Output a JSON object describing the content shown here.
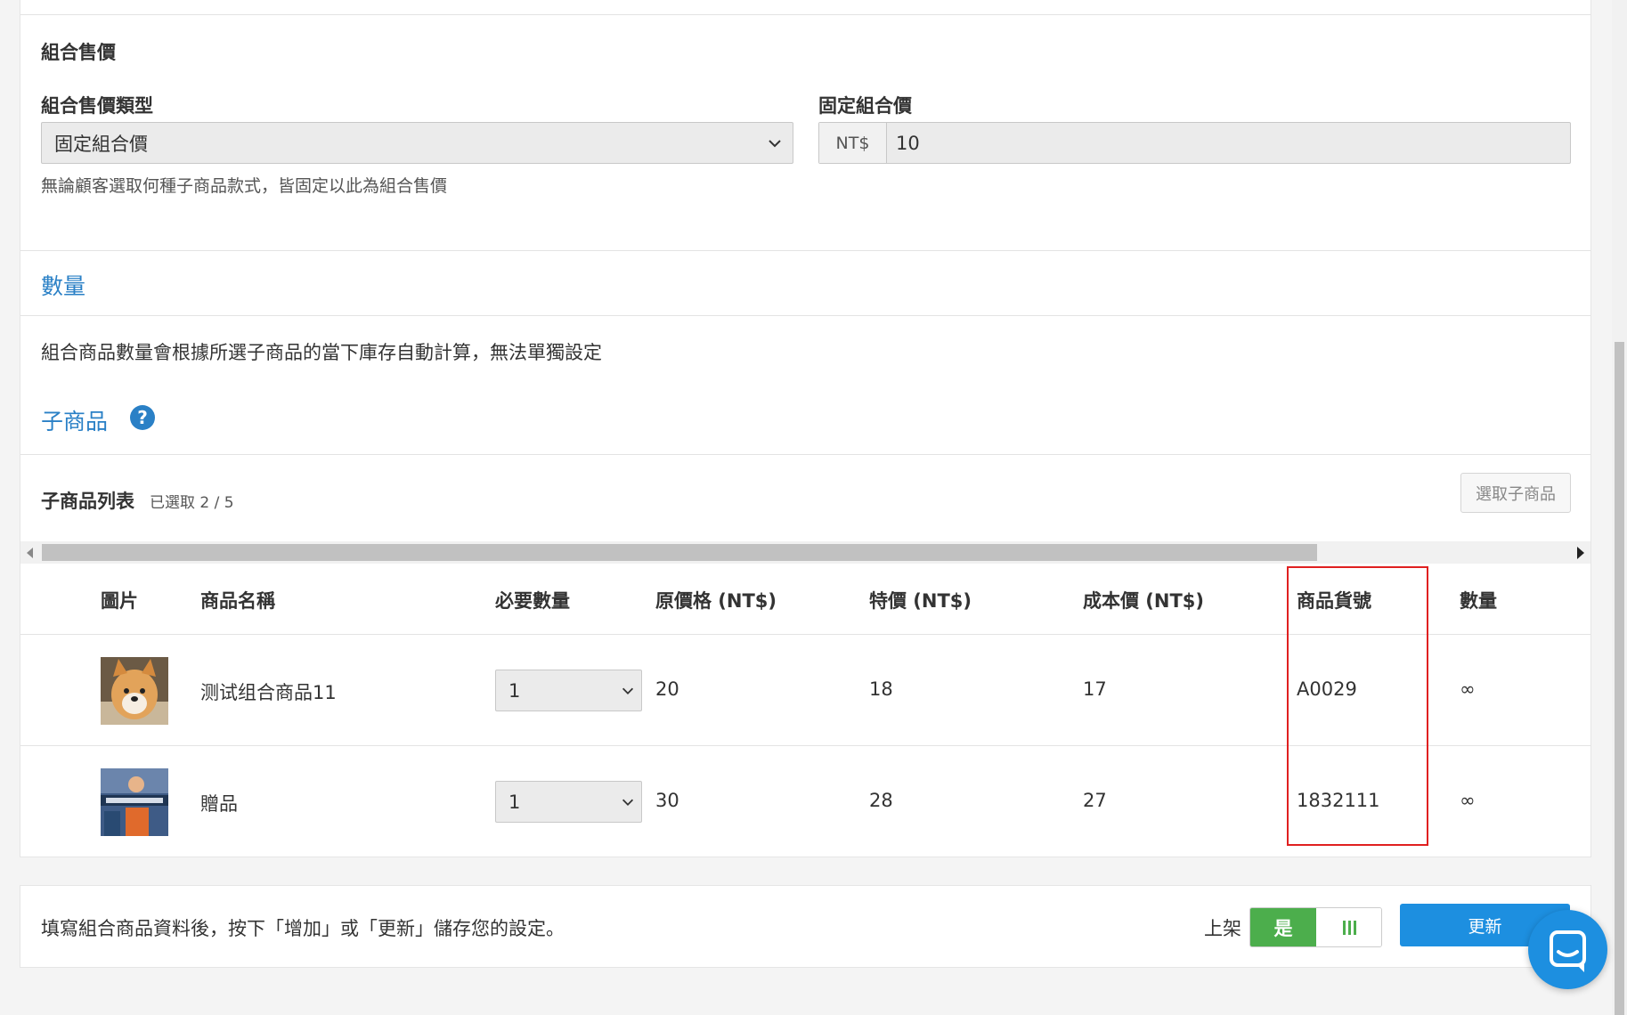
{
  "pricing": {
    "section_title": "組合售價",
    "type_label": "組合售價類型",
    "type_value": "固定組合價",
    "type_hint": "無論顧客選取何種子商品款式，皆固定以此為組合售價",
    "fixed_label": "固定組合價",
    "currency": "NT$",
    "fixed_value": "10"
  },
  "quantity": {
    "heading": "數量",
    "description": "組合商品數量會根據所選子商品的當下庫存自動計算，無法單獨設定"
  },
  "sub_products": {
    "heading": "子商品",
    "help_icon": "question-circle-icon",
    "list_title": "子商品列表",
    "selected_count": "已選取 2 / 5",
    "pick_button": "選取子商品",
    "columns": [
      "圖片",
      "商品名稱",
      "必要數量",
      "原價格 (NT$)",
      "特價 (NT$)",
      "成本價 (NT$)",
      "商品貨號",
      "數量"
    ],
    "rows": [
      {
        "image": "shiba-dog-photo",
        "name": "测试组合商品11",
        "required_qty": "1",
        "original_price": "20",
        "sale_price": "18",
        "cost": "17",
        "sku": "A0029",
        "stock": "∞"
      },
      {
        "image": "gift-banner-photo",
        "name": "贈品",
        "required_qty": "1",
        "original_price": "30",
        "sale_price": "28",
        "cost": "27",
        "sku": "1832111",
        "stock": "∞"
      }
    ]
  },
  "footer": {
    "instruction": "填寫組合商品資料後，按下「增加」或「更新」儲存您的設定。",
    "listed_label": "上架",
    "toggle_on": "是",
    "toggle_off_icon": "bars-icon",
    "update_button": "更新"
  },
  "colors": {
    "link_blue": "#2a80c6",
    "primary_button": "#1d8fe0",
    "toggle_green": "#4cae4c",
    "highlight_red": "#e02020"
  }
}
